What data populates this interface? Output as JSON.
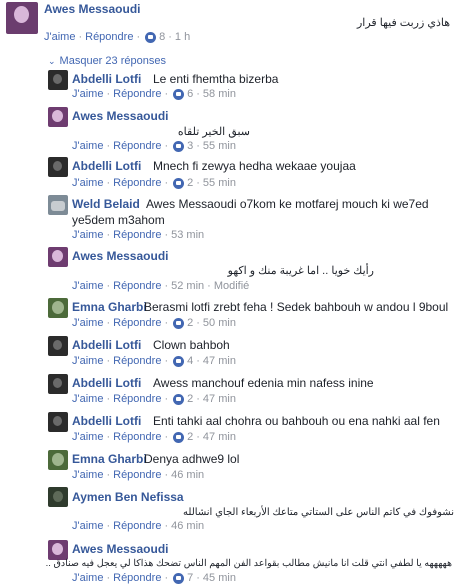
{
  "top": {
    "author": "Awes Messaoudi",
    "text": "هاذي زربت فيها قرار",
    "like": "J'aime",
    "reply": "Répondre",
    "likes": "8",
    "time": "1 h"
  },
  "hide_replies": "Masquer 23 réponses",
  "replies": [
    {
      "author": "Abdelli Lotfi",
      "text": "Le enti fhemtha bizerba",
      "like": "J'aime",
      "reply": "Répondre",
      "likes": "6",
      "time": "58 min"
    },
    {
      "author": "Awes Messaoudi",
      "text": "سبق الخير تلقاه",
      "like": "J'aime",
      "reply": "Répondre",
      "likes": "3",
      "time": "55 min"
    },
    {
      "author": "Abdelli Lotfi",
      "text": "Mnech fi zewya hedha wekaae youjaa",
      "like": "J'aime",
      "reply": "Répondre",
      "likes": "2",
      "time": "55 min"
    },
    {
      "author": "Weld Belaid",
      "text_line1": "Awes Messaoudi o7kom ke motfarej mouch ki we7ed",
      "text_line2": "ye5dem m3ahom",
      "like": "J'aime",
      "reply": "Répondre",
      "time": "53 min"
    },
    {
      "author": "Awes Messaoudi",
      "text": "رأيك خويا .. اما غريبة منك و اكهو",
      "like": "J'aime",
      "reply": "Répondre",
      "time": "52 min",
      "edited": "Modifié"
    },
    {
      "author": "Emna Gharbi",
      "text": "Berasmi lotfi zrebt feha ! Sedek bahbouh w andou l 9boul",
      "like": "J'aime",
      "reply": "Répondre",
      "likes": "2",
      "time": "50 min"
    },
    {
      "author": "Abdelli Lotfi",
      "text": "Clown bahboh",
      "like": "J'aime",
      "reply": "Répondre",
      "likes": "4",
      "time": "47 min"
    },
    {
      "author": "Abdelli Lotfi",
      "text": "Awess manchouf edenia min nafess inine",
      "like": "J'aime",
      "reply": "Répondre",
      "likes": "2",
      "time": "47 min"
    },
    {
      "author": "Abdelli Lotfi",
      "text": "Enti tahki aal chohra ou bahbouh ou ena nahki aal fen",
      "like": "J'aime",
      "reply": "Répondre",
      "likes": "2",
      "time": "47 min"
    },
    {
      "author": "Emna Gharbi",
      "text": "Denya adhwe9 lol",
      "like": "J'aime",
      "reply": "Répondre",
      "time": "46 min"
    },
    {
      "author": "Aymen Ben Nefissa",
      "text": "نشوفوك في كاتم الناس على الستاتي متاعك الأربعاء الجاي انشالله",
      "like": "J'aime",
      "reply": "Répondre",
      "time": "46 min"
    },
    {
      "author": "Awes Messaoudi",
      "text": "هههههه يا لطفي انتي قلت انا مانيش مطالب بقواعد الفن المهم الناس تضحك هذاكا لي يعجل فيه صنادق ..",
      "like": "J'aime",
      "reply": "Répondre",
      "likes": "7",
      "time": "45 min"
    }
  ]
}
